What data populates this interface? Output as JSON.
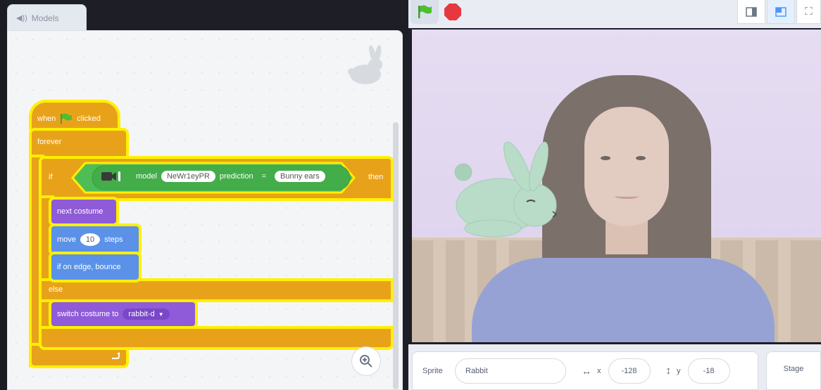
{
  "tab": {
    "icon": "speaker-icon",
    "label": "Models"
  },
  "blocks": {
    "hat": {
      "when": "when",
      "clicked": "clicked"
    },
    "forever": "forever",
    "if": "if",
    "then": "then",
    "else": "else",
    "condition": {
      "model_label": "model",
      "model_id": "NeWr1eyPR",
      "prediction_label": "prediction",
      "equals": "=",
      "value": "Bunny ears"
    },
    "next_costume": "next costume",
    "move": {
      "label": "move",
      "steps_value": "10",
      "steps_label": "steps"
    },
    "bounce": "if on edge, bounce",
    "switch_costume": {
      "label": "switch costume to",
      "costume": "rabbit-d"
    }
  },
  "sprite_info": {
    "sprite_label": "Sprite",
    "sprite_name": "Rabbit",
    "x_label": "x",
    "x_value": "-128",
    "y_label": "y",
    "y_value": "-18"
  },
  "stage_label": "Stage",
  "colors": {
    "events": "#e8a21a",
    "looks": "#8f5bd8",
    "motion": "#5b92e8",
    "extension": "#4fbd56",
    "highlight": "#fff000"
  }
}
